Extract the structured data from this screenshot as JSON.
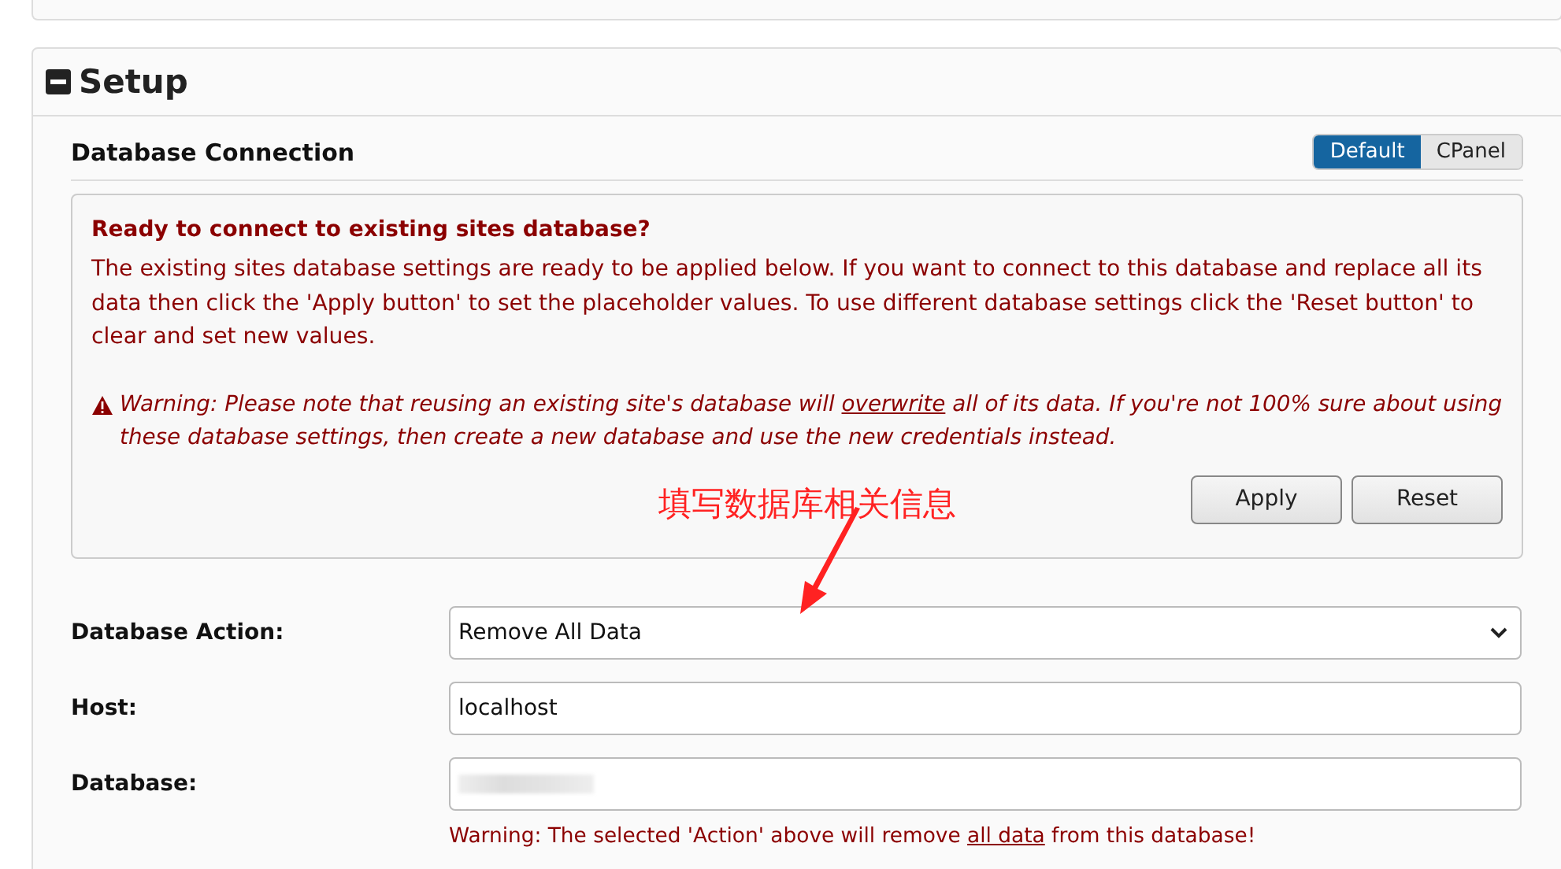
{
  "panel": {
    "title": "Setup",
    "expanded": true
  },
  "section": {
    "title": "Database Connection",
    "modes": [
      {
        "label": "Default",
        "selected": true
      },
      {
        "label": "CPanel",
        "selected": false
      }
    ]
  },
  "notice": {
    "title": "Ready to connect to existing sites database?",
    "body": "The existing sites database settings are ready to be applied below. If you want to connect to this database and replace all its data then click the 'Apply button' to set the placeholder values. To use different database settings click the 'Reset button' to clear and set new values.",
    "warning": [
      {
        "text": "Warning: Please note that reusing an existing site's database will ",
        "underline": false
      },
      {
        "text": "overwrite",
        "underline": true
      },
      {
        "text": " all of its data. If you're not 100% sure about using these database settings, then create a new database and use the new credentials instead.",
        "underline": false
      }
    ],
    "buttons": [
      "Apply",
      "Reset"
    ]
  },
  "annotation": {
    "text": "填写数据库相关信息"
  },
  "fields": [
    {
      "kind": "select",
      "label": "Database Action:",
      "value": "Remove All Data"
    },
    {
      "kind": "text",
      "label": "Host:",
      "value": "localhost"
    },
    {
      "kind": "redacted",
      "label": "Database:",
      "hint": [
        {
          "text": "Warning: The selected 'Action' above will remove ",
          "underline": false
        },
        {
          "text": "all data",
          "underline": true
        },
        {
          "text": " from this database!",
          "underline": false
        }
      ]
    }
  ]
}
